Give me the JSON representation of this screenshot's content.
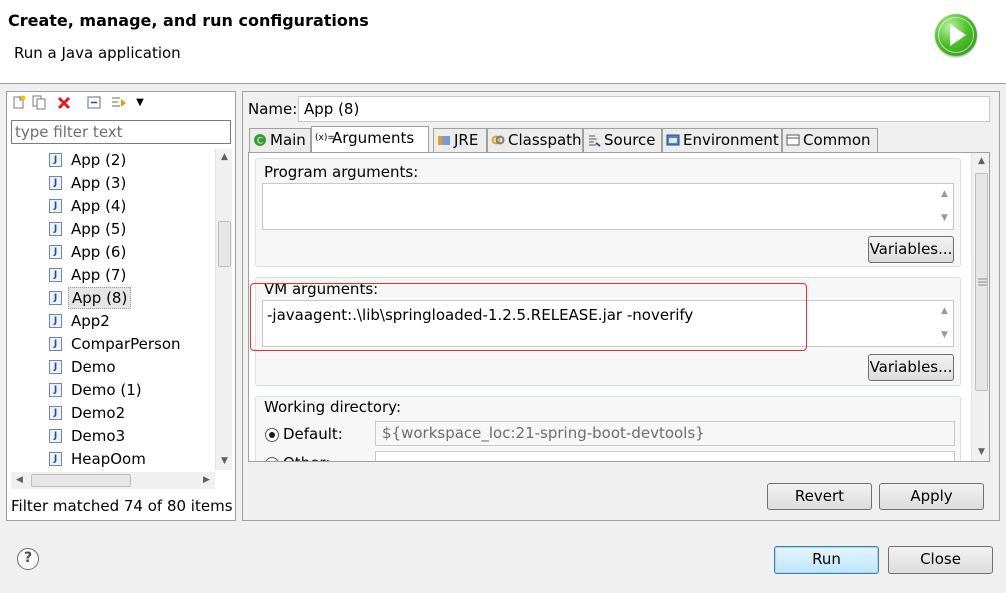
{
  "header": {
    "title": "Create, manage, and run configurations",
    "subtitle": "Run a Java application",
    "logo_icon": "run-launch-icon"
  },
  "left": {
    "toolbar_icons": [
      "new-config-icon",
      "duplicate-icon",
      "delete-icon",
      "collapse-all-icon",
      "filter-icon",
      "dropdown-arrow-icon"
    ],
    "filter_placeholder": "type filter text",
    "items": [
      {
        "label": "App (2)"
      },
      {
        "label": "App (3)"
      },
      {
        "label": "App (4)"
      },
      {
        "label": "App (5)"
      },
      {
        "label": "App (6)"
      },
      {
        "label": "App (7)"
      },
      {
        "label": "App (8)",
        "selected": true
      },
      {
        "label": "App2"
      },
      {
        "label": "ComparPerson"
      },
      {
        "label": "Demo"
      },
      {
        "label": "Demo (1)"
      },
      {
        "label": "Demo2"
      },
      {
        "label": "Demo3"
      },
      {
        "label": "HeapOom"
      }
    ],
    "filter_status": "Filter matched 74 of 80 items"
  },
  "right": {
    "name_label": "Name:",
    "name_value": "App (8)",
    "tabs": [
      {
        "label": "Main",
        "icon": "main-class-icon"
      },
      {
        "label": "Arguments",
        "icon": "arguments-icon",
        "active": true
      },
      {
        "label": "JRE",
        "icon": "jre-icon"
      },
      {
        "label": "Classpath",
        "icon": "classpath-icon"
      },
      {
        "label": "Source",
        "icon": "source-icon"
      },
      {
        "label": "Environment",
        "icon": "environment-icon"
      },
      {
        "label": "Common",
        "icon": "common-icon"
      }
    ],
    "program_args_label": "Program arguments:",
    "program_args_value": "",
    "variables_label": "Variables...",
    "vm_args_label": "VM arguments:",
    "vm_args_value": "-javaagent:.\\lib\\springloaded-1.2.5.RELEASE.jar -noverify",
    "working_dir_label": "Working directory:",
    "default_label": "Default:",
    "default_value": "${workspace_loc:21-spring-boot-devtools}",
    "other_label": "Other:",
    "revert_label": "Revert",
    "apply_label": "Apply"
  },
  "footer": {
    "run_label": "Run",
    "close_label": "Close",
    "help_icon": "help-icon"
  },
  "colors": {
    "highlight": "#e03030",
    "default_button": "#bee6fd"
  }
}
